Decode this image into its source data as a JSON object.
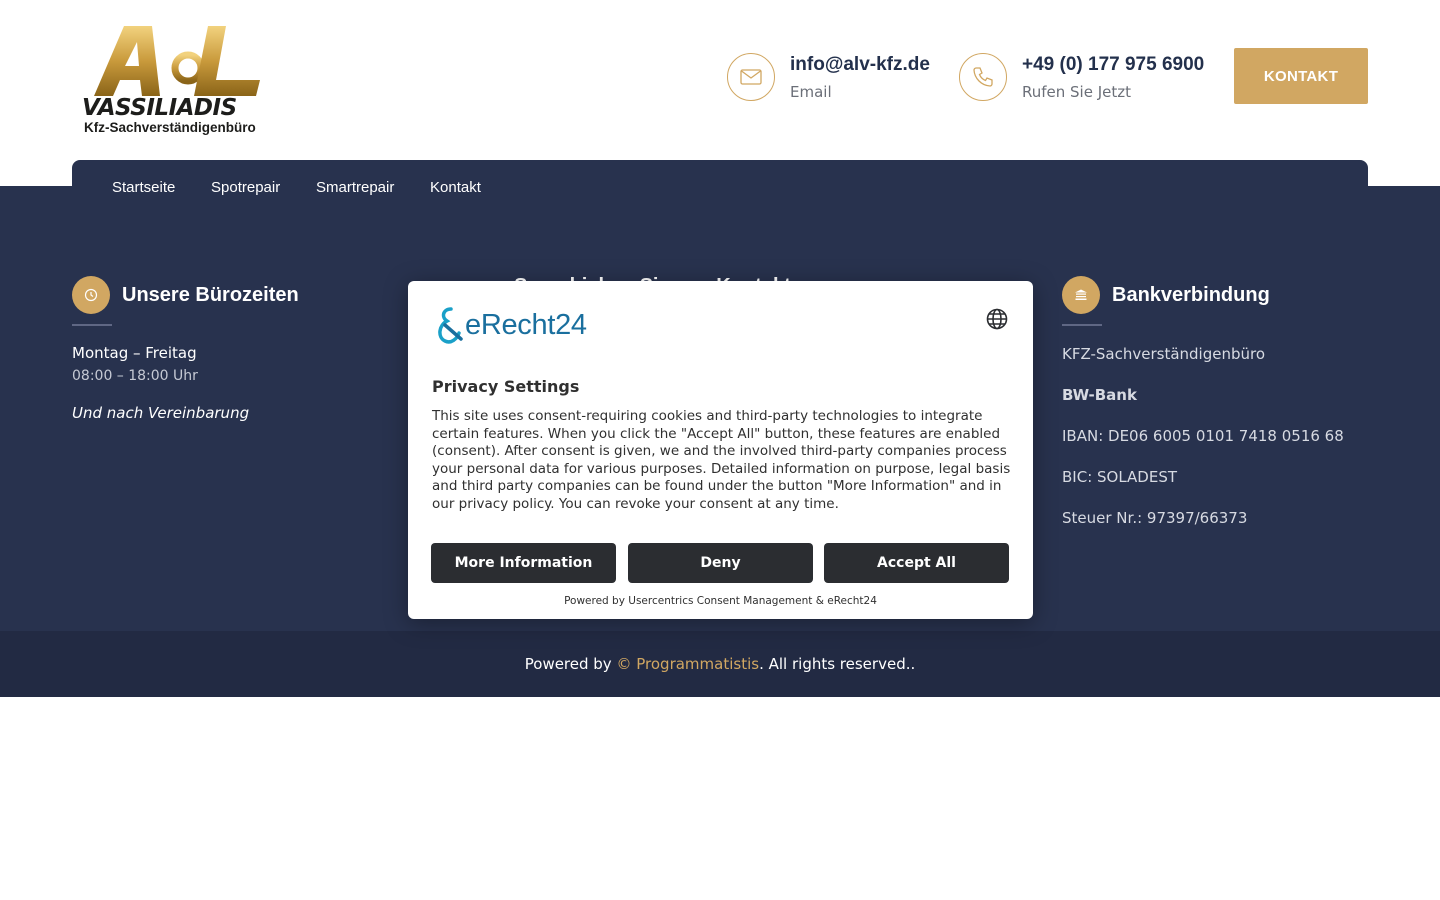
{
  "logo": {
    "big": "VASSILIADIS",
    "small": "Kfz-Sachverständigenbüro"
  },
  "header": {
    "email": {
      "value": "info@alv-kfz.de",
      "label": "Email",
      "icon": "mail-icon"
    },
    "phone": {
      "value": "+49 (0) 177 975 6900",
      "label": "Rufen Sie Jetzt",
      "icon": "phone-icon"
    },
    "cta_label": "KONTAKT"
  },
  "nav": {
    "items": [
      "Startseite",
      "Spotrepair",
      "Smartrepair",
      "Kontakt"
    ]
  },
  "footer": {
    "hours": {
      "title": "Unsere Bürozeiten",
      "icon": "clock-icon",
      "days": "Montag – Freitag",
      "time": "08:00 – 18:00 Uhr",
      "note": "Und nach Vereinbarung"
    },
    "middle_heading": "Sprechiehen Sie uns Kontakt",
    "bank": {
      "title": "Bankverbindung",
      "icon": "bank-icon",
      "company": "KFZ-Sachverständigenbüro",
      "bank_name": "BW-Bank",
      "iban": "IBAN: DE06 6005 0101 7418 0516 68",
      "bic": "BIC: SOLADEST",
      "tax": "Steuer Nr.: 97397/66373"
    },
    "bottom": {
      "prefix": "Powered by ",
      "link": "© Programmatistis",
      "suffix": ". All rights reserved.."
    }
  },
  "consent": {
    "brand": "eRecht24",
    "title": "Privacy Settings",
    "text": "This site uses consent-requiring cookies and third-party technologies to integrate certain features. When you click the \"Accept All\" button, these features are enabled (consent). After consent is given, we and the involved third-party companies process your personal data for various purposes. Detailed information on purpose, legal basis and third party companies can be found under the button \"More Information\" and in our privacy policy. You can revoke your consent at any time.",
    "buttons": {
      "more": "More Information",
      "deny": "Deny",
      "accept": "Accept All"
    },
    "powered": "Powered by Usercentrics Consent Management & eRecht24"
  },
  "colors": {
    "gold": "#d1a762",
    "navy": "#28324e",
    "navy_dark": "#222a43",
    "erecht_blue": "#1a6f9e"
  }
}
